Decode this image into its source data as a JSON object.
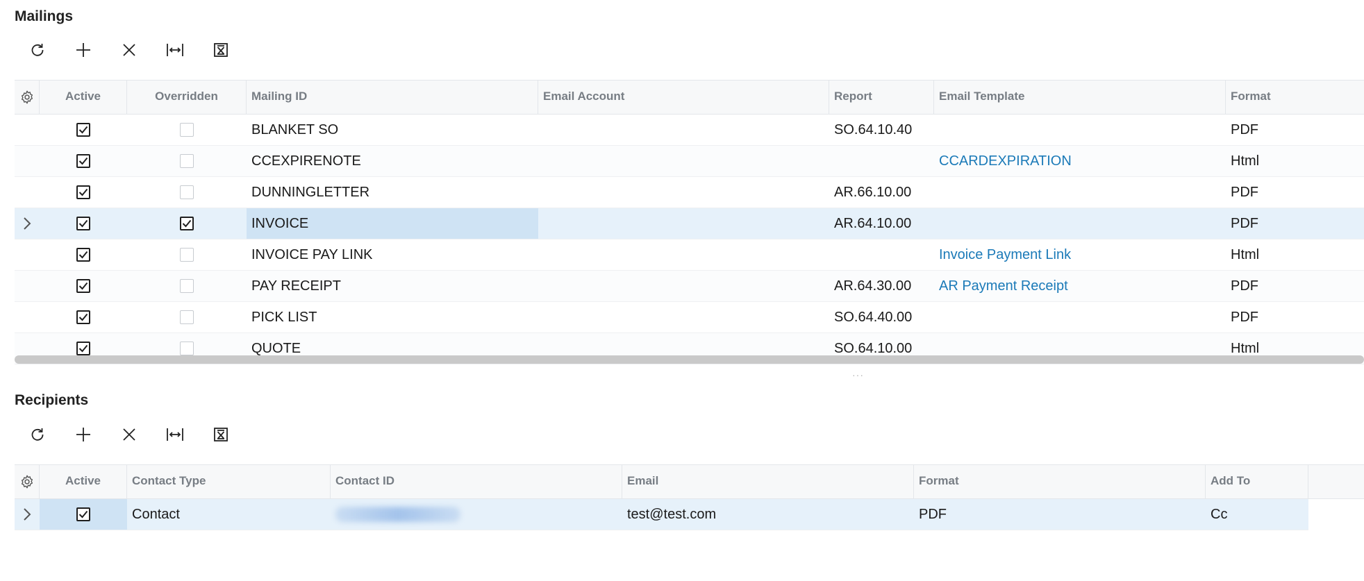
{
  "mailings": {
    "title": "Mailings",
    "columns": [
      "Active",
      "Overridden",
      "Mailing ID",
      "Email Account",
      "Report",
      "Email Template",
      "Format"
    ],
    "rows": [
      {
        "active": true,
        "overridden": false,
        "mailing_id": "BLANKET SO",
        "email_account": "",
        "report": "SO.64.10.40",
        "email_template": "",
        "format": "PDF"
      },
      {
        "active": true,
        "overridden": false,
        "mailing_id": "CCEXPIRENOTE",
        "email_account": "",
        "report": "",
        "email_template": "CCARDEXPIRATION",
        "format": "Html"
      },
      {
        "active": true,
        "overridden": false,
        "mailing_id": "DUNNINGLETTER",
        "email_account": "",
        "report": "AR.66.10.00",
        "email_template": "",
        "format": "PDF"
      },
      {
        "active": true,
        "overridden": true,
        "mailing_id": "INVOICE",
        "email_account": "",
        "report": "AR.64.10.00",
        "email_template": "",
        "format": "PDF"
      },
      {
        "active": true,
        "overridden": false,
        "mailing_id": "INVOICE PAY LINK",
        "email_account": "",
        "report": "",
        "email_template": "Invoice Payment Link",
        "format": "Html"
      },
      {
        "active": true,
        "overridden": false,
        "mailing_id": "PAY RECEIPT",
        "email_account": "",
        "report": "AR.64.30.00",
        "email_template": "AR Payment Receipt",
        "format": "PDF"
      },
      {
        "active": true,
        "overridden": false,
        "mailing_id": "PICK LIST",
        "email_account": "",
        "report": "SO.64.40.00",
        "email_template": "",
        "format": "PDF"
      },
      {
        "active": true,
        "overridden": false,
        "mailing_id": "QUOTE",
        "email_account": "",
        "report": "SO.64.10.00",
        "email_template": "",
        "format": "Html"
      }
    ]
  },
  "recipients": {
    "title": "Recipients",
    "columns": [
      "Active",
      "Contact Type",
      "Contact ID",
      "Email",
      "Format",
      "Add To"
    ],
    "rows": [
      {
        "active": true,
        "contact_type": "Contact",
        "contact_id": "",
        "email": "test@test.com",
        "format": "PDF",
        "add_to": "Cc"
      }
    ]
  },
  "toolbar": {
    "icons": [
      "refresh-icon",
      "add-icon",
      "delete-icon",
      "fit-columns-icon",
      "export-excel-icon"
    ]
  },
  "colors": {
    "link": "#1b7ab8",
    "selected_row": "#e6f1fa",
    "selected_cell": "#cfe3f4",
    "header_bg": "#f7f8f9",
    "header_text": "#777d84"
  }
}
